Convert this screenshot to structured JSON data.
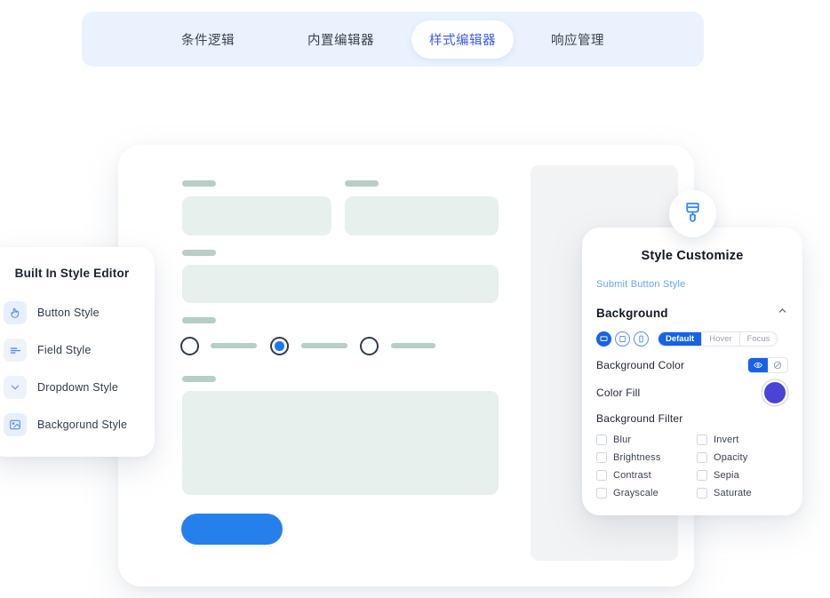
{
  "tabs": [
    {
      "label": "条件逻辑",
      "active": false
    },
    {
      "label": "内置编辑器",
      "active": false
    },
    {
      "label": "样式编辑器",
      "active": true
    },
    {
      "label": "响应管理",
      "active": false
    }
  ],
  "sidebar": {
    "title": "Built In Style Editor",
    "items": [
      {
        "label": "Button Style",
        "icon": "click-hand-icon"
      },
      {
        "label": "Field Style",
        "icon": "field-lines-icon"
      },
      {
        "label": "Dropdown Style",
        "icon": "chevron-down-icon"
      },
      {
        "label": "Backgorund Style",
        "icon": "image-icon"
      }
    ]
  },
  "form_preview": {
    "submit_button_color": "#2680ec",
    "label_color": "#b6cfc4",
    "field_color": "#e7f0ec",
    "selected_radio_index": 1,
    "radio_count": 3
  },
  "style_panel": {
    "badge_icon": "paint-brush-icon",
    "title": "Style Customize",
    "subtitle": "Submit Button Style",
    "section": {
      "name": "Background",
      "collapse_icon": "chevron-up-icon",
      "expanded": true
    },
    "devices": [
      {
        "name": "desktop",
        "selected": true
      },
      {
        "name": "tablet",
        "selected": false
      },
      {
        "name": "mobile",
        "selected": false
      }
    ],
    "states": [
      {
        "label": "Default",
        "selected": true
      },
      {
        "label": "Hover",
        "selected": false
      },
      {
        "label": "Focus",
        "selected": false
      }
    ],
    "background_color": {
      "label": "Background Color",
      "visible_selected": true
    },
    "color_fill": {
      "label": "Color Fill",
      "value": "#4b42d6"
    },
    "background_filter": {
      "label": "Background Filter",
      "options": [
        {
          "label": "Blur",
          "checked": false
        },
        {
          "label": "Invert",
          "checked": false
        },
        {
          "label": "Brightness",
          "checked": false
        },
        {
          "label": "Opacity",
          "checked": false
        },
        {
          "label": "Contrast",
          "checked": false
        },
        {
          "label": "Sepia",
          "checked": false
        },
        {
          "label": "Grayscale",
          "checked": false
        },
        {
          "label": "Saturate",
          "checked": false
        }
      ]
    }
  },
  "colors": {
    "accent_blue": "#1763e8",
    "tabbar_bg": "#eaf2fd",
    "active_tab_text": "#3a5cf0",
    "link_blue": "#63a4f8"
  }
}
